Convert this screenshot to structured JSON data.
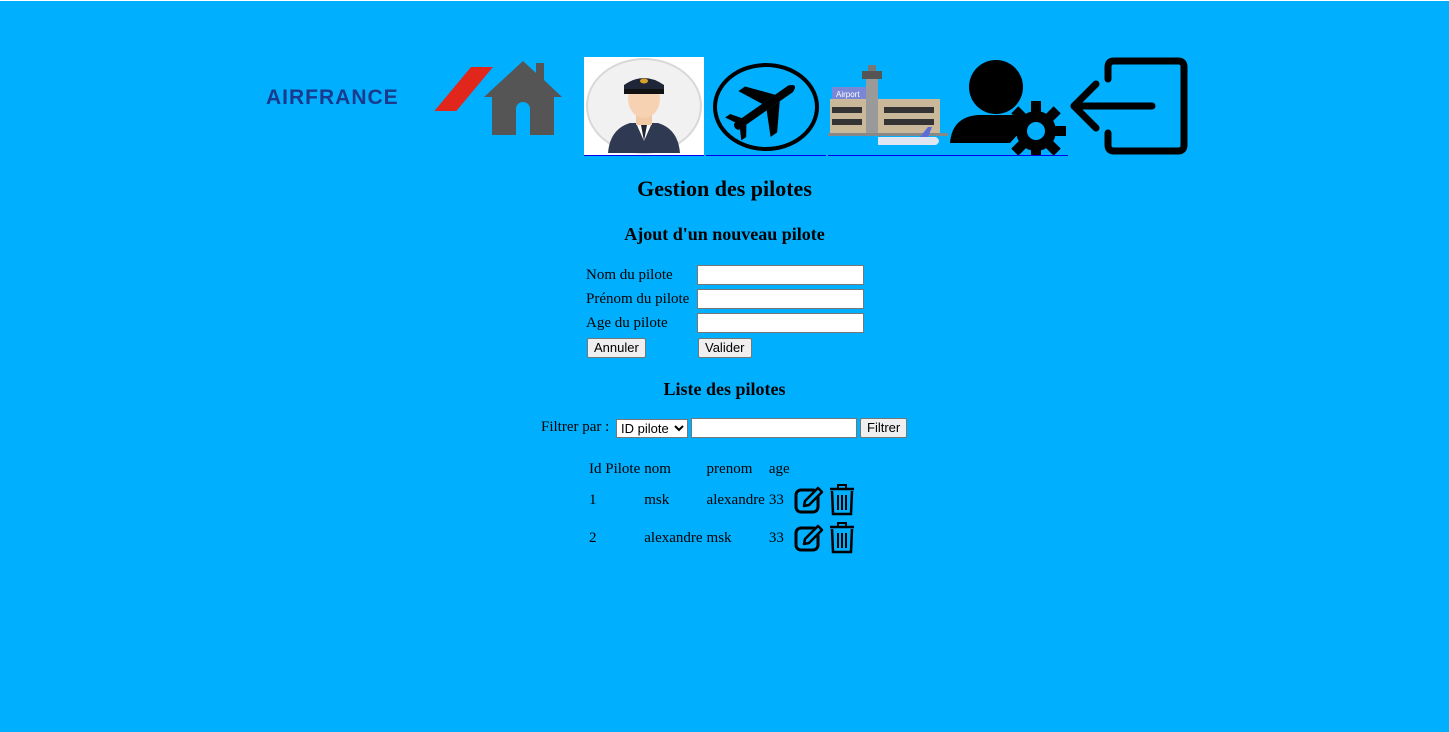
{
  "brand": {
    "logo_text": "AIRFRANCE",
    "logo_color": "#1a3a8e",
    "stripe_color": "#e1261c"
  },
  "nav": {
    "items": [
      {
        "icon": "home-icon"
      },
      {
        "icon": "pilot-icon"
      },
      {
        "icon": "airplane-icon"
      },
      {
        "icon": "airport-icon",
        "label": "Airport"
      },
      {
        "icon": "user-settings-icon"
      },
      {
        "icon": "logout-icon"
      }
    ]
  },
  "page": {
    "title": "Gestion des pilotes",
    "background": "#00b0ff"
  },
  "add_form": {
    "heading": "Ajout d'un nouveau pilote",
    "fields": [
      {
        "label": "Nom du pilote",
        "value": ""
      },
      {
        "label": "Prénom du pilote",
        "value": ""
      },
      {
        "label": "Age du pilote",
        "value": ""
      }
    ],
    "cancel_label": "Annuler",
    "submit_label": "Valider"
  },
  "list": {
    "heading": "Liste des pilotes",
    "filter_label": "Filtrer par :",
    "filter_selected": "ID pilote",
    "filter_value": "",
    "filter_button": "Filtrer",
    "columns": [
      "Id Pilote",
      "nom",
      "prenom",
      "age"
    ],
    "rows": [
      {
        "id": "1",
        "nom": "msk",
        "prenom": "alexandre",
        "age": "33"
      },
      {
        "id": "2",
        "nom": "alexandre",
        "prenom": "msk",
        "age": "33"
      }
    ],
    "row_actions": [
      "edit-icon",
      "trash-icon"
    ]
  }
}
